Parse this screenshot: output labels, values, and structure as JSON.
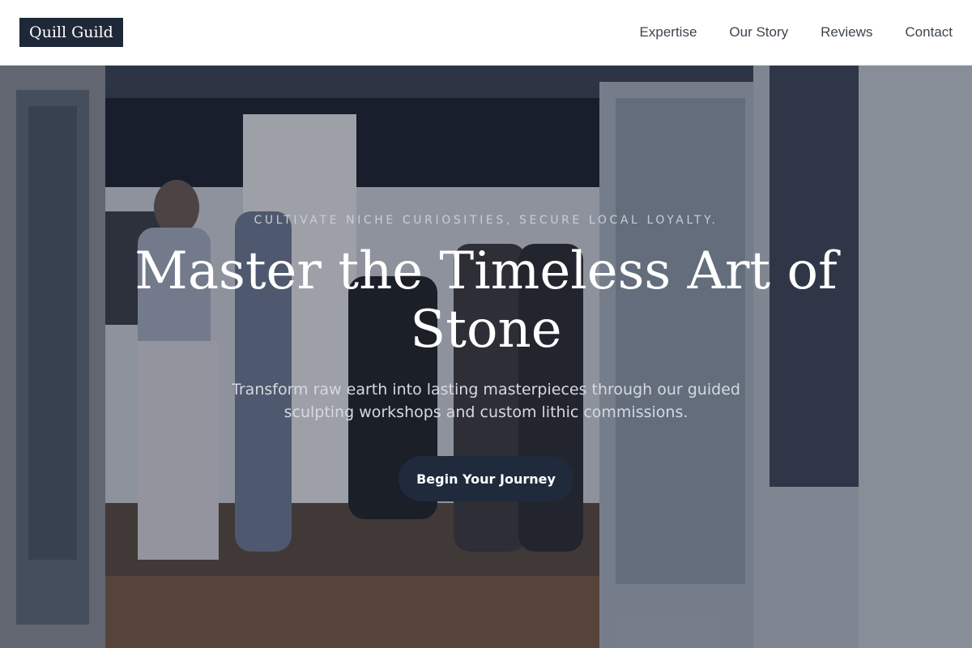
{
  "header": {
    "logo": "Quill Guild",
    "nav": [
      {
        "label": "Expertise"
      },
      {
        "label": "Our Story"
      },
      {
        "label": "Reviews"
      },
      {
        "label": "Contact"
      }
    ]
  },
  "hero": {
    "eyebrow": "CULTIVATE NICHE CURIOSITIES, SECURE LOCAL LOYALTY.",
    "headline": "Master the Timeless Art of Stone",
    "subtext": "Transform raw earth into lasting masterpieces through our guided sculpting workshops and custom lithic commissions.",
    "cta_label": "Begin Your Journey"
  },
  "colors": {
    "header_bg": "#ffffff",
    "logo_bg": "#1e2838",
    "cta_bg": "#1f2a3c",
    "hero_overlay": "#141a28"
  }
}
